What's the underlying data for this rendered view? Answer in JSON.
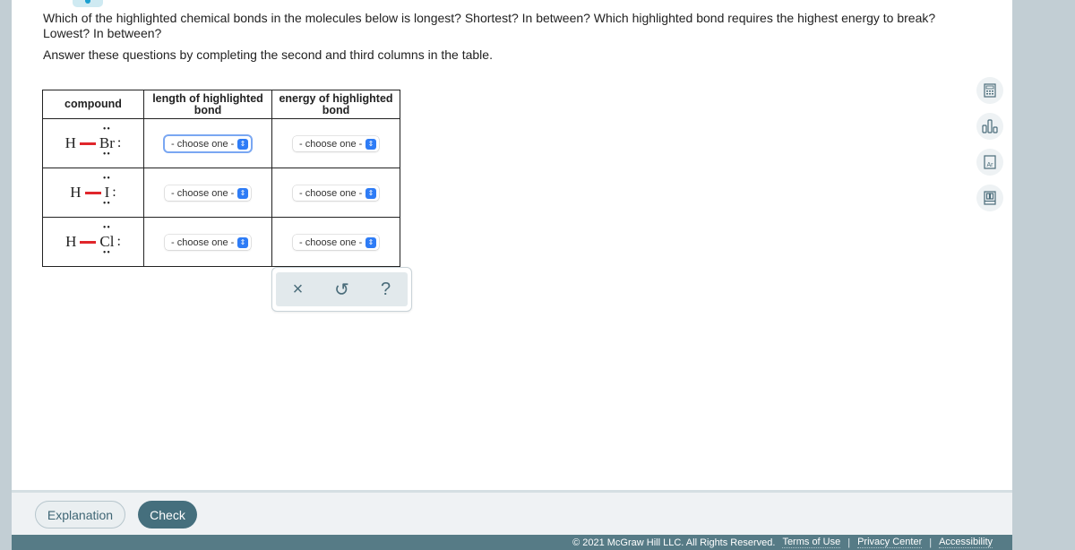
{
  "question": {
    "text": "Which of the highlighted chemical bonds in the molecules below is longest? Shortest? In between? Which highlighted bond requires the highest energy to break? Lowest? In between?",
    "instruction": "Answer these questions by completing the second and third columns in the table."
  },
  "table": {
    "headers": [
      "compound",
      "length of highlighted bond",
      "energy of highlighted bond"
    ],
    "rows": [
      {
        "h": "H",
        "x": "Br",
        "length": "- choose one -",
        "energy": "- choose one -"
      },
      {
        "h": "H",
        "x": "I",
        "length": "- choose one -",
        "energy": "- choose one -"
      },
      {
        "h": "H",
        "x": "Cl",
        "length": "- choose one -",
        "energy": "- choose one -"
      }
    ],
    "bond_color": "#e0262b"
  },
  "toolbar": {
    "clear_icon": "×",
    "undo_icon": "↺",
    "help_icon": "?"
  },
  "side_tools": [
    "calculator-icon",
    "bar-chart-icon",
    "periodic-table-icon",
    "reference-book-icon"
  ],
  "footer": {
    "explanation_label": "Explanation",
    "check_label": "Check",
    "copyright": "© 2021 McGraw Hill LLC. All Rights Reserved.",
    "terms": "Terms of Use",
    "privacy": "Privacy Center",
    "accessibility": "Accessibility",
    "sep": "|"
  }
}
